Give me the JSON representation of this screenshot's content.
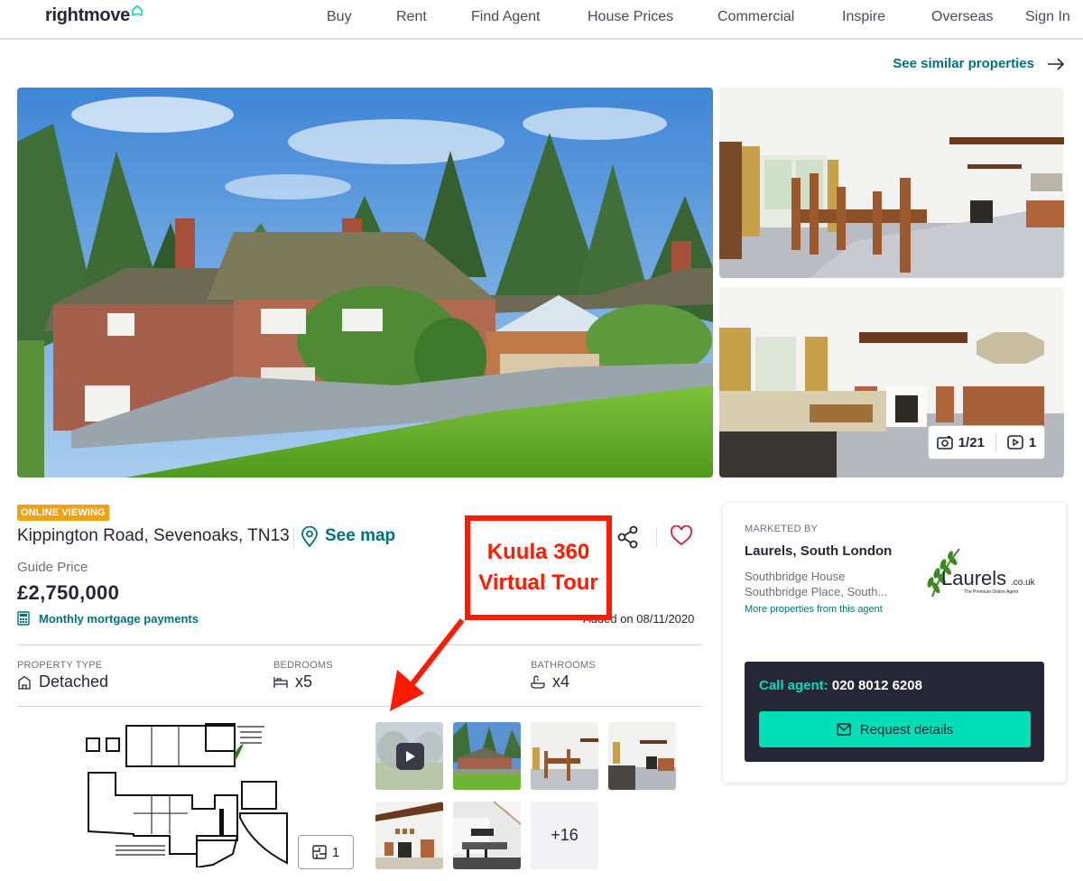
{
  "header": {
    "logo": "rightmove",
    "nav": [
      "Buy",
      "Rent",
      "Find Agent",
      "House Prices",
      "Commercial",
      "Inspire",
      "Overseas",
      "Sign In"
    ]
  },
  "similar_link": "See similar properties",
  "gallery": {
    "photo_counter": "1/21",
    "video_counter": "1",
    "floorplan_counter": "1",
    "more_count": "+16"
  },
  "listing": {
    "badge": "ONLINE VIEWING",
    "address": "Kippington Road, Sevenoaks, TN13",
    "see_map": "See map",
    "price_label": "Guide Price",
    "price": "£2,750,000",
    "mortgage_link": "Monthly mortgage payments",
    "added": "Added on 08/11/2020"
  },
  "stats": [
    {
      "label": "PROPERTY TYPE",
      "value": "Detached",
      "icon": "house-icon"
    },
    {
      "label": "BEDROOMS",
      "value": "x5",
      "icon": "bed-icon"
    },
    {
      "label": "BATHROOMS",
      "value": "x4",
      "icon": "bath-icon"
    }
  ],
  "annotation": {
    "line1": "Kuula 360",
    "line2": "Virtual Tour",
    "color": "#ff1a00"
  },
  "agent": {
    "marketed_by": "MARKETED BY",
    "name": "Laurels, South London",
    "address_line1": "Southbridge House",
    "address_line2": "Southbridge Place, South...",
    "more_link": "More properties from this agent",
    "logo_text": "Laurels",
    "logo_suffix": ".co.uk",
    "logo_tagline": "The Premium Online Agent",
    "call_label": "Call agent:",
    "phone": "020 8012 6208",
    "request_button": "Request details"
  },
  "colors": {
    "brand_teal": "#00deb6",
    "link_teal": "#00737a",
    "dark": "#262637",
    "badge_orange": "#f2a114"
  }
}
